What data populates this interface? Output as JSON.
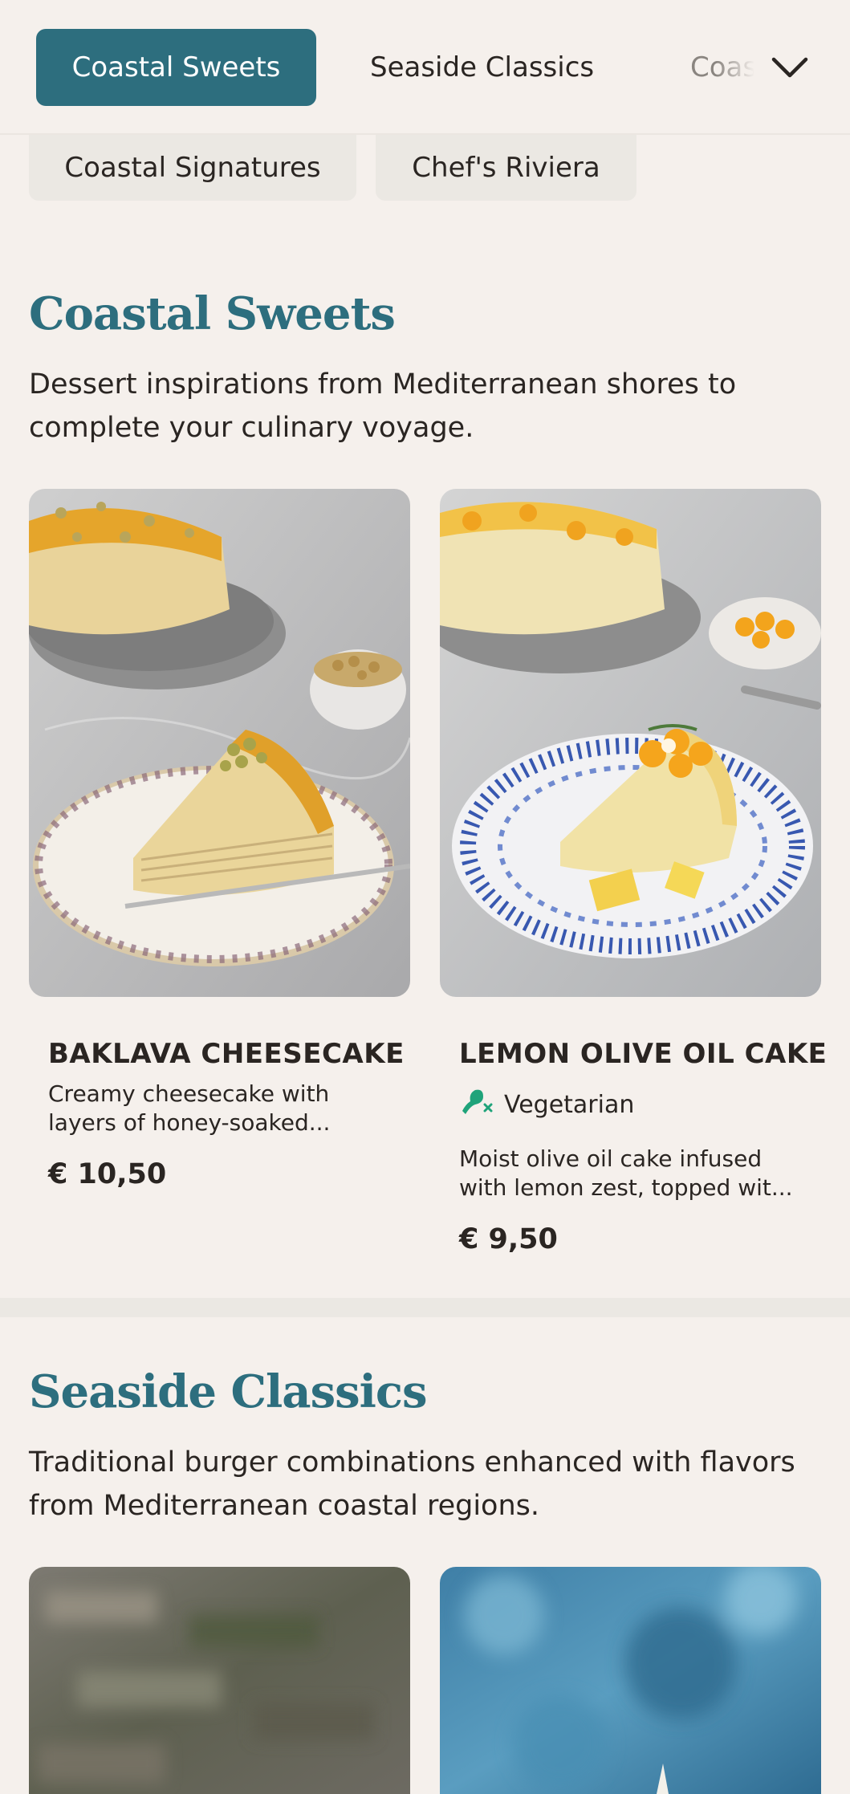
{
  "nav": {
    "tabs": [
      {
        "label": "Coastal Sweets"
      },
      {
        "label": "Seaside Classics"
      },
      {
        "label": "Coastal Signatures"
      }
    ],
    "chips": [
      {
        "label": "Coastal Signatures"
      },
      {
        "label": "Chef's Riviera"
      }
    ]
  },
  "sections": [
    {
      "title": "Coastal Sweets",
      "description": "Dessert inspirations from Mediterranean shores to complete your culinary voyage.",
      "items": [
        {
          "name": "BAKLAVA CHEESECAKE",
          "description": "Creamy cheesecake with layers of honey-soaked...",
          "price": "€ 10,50"
        },
        {
          "name": "LEMON OLIVE OIL CAKE",
          "tag": "Vegetarian",
          "description": "Moist olive oil cake infused with lemon zest, topped wit...",
          "price": "€ 9,50"
        }
      ]
    },
    {
      "title": "Seaside Classics",
      "description": "Traditional burger combinations enhanced with flavors from Mediterranean coastal regions."
    }
  ],
  "colors": {
    "accent": "#2d6e7e",
    "background": "#f5f0ec",
    "vegetarian": "#1fa37a"
  }
}
